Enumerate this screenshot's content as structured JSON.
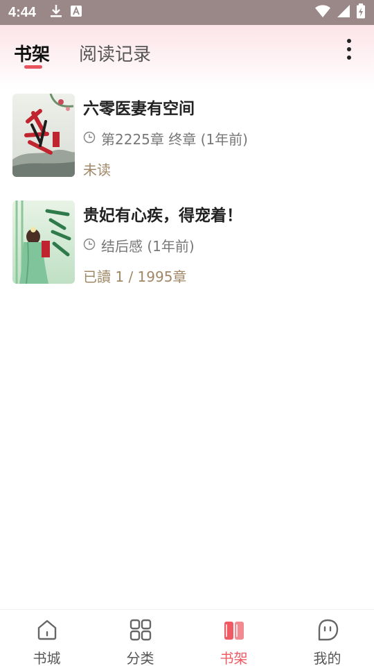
{
  "status_bar": {
    "time": "4:44",
    "icons": [
      "download-icon",
      "a-badge-icon",
      "wifi-icon",
      "signal-icon",
      "battery-icon"
    ]
  },
  "header": {
    "tabs": [
      {
        "label": "书架",
        "active": true
      },
      {
        "label": "阅读记录",
        "active": false
      }
    ],
    "more_icon": "more-vertical-icon"
  },
  "books": [
    {
      "title": "六零医妻有空间",
      "chapter": "第2225章 终章 (1年前)",
      "progress": "未读"
    },
    {
      "title": "贵妃有心疾，得宠着！",
      "chapter": "结后感 (1年前)",
      "progress": "已讀 1 / 1995章"
    }
  ],
  "bottom_nav": [
    {
      "label": "书城",
      "icon": "home-icon",
      "active": false
    },
    {
      "label": "分类",
      "icon": "grid-icon",
      "active": false
    },
    {
      "label": "书架",
      "icon": "bookshelf-icon",
      "active": true
    },
    {
      "label": "我的",
      "icon": "profile-face-icon",
      "active": false
    }
  ],
  "colors": {
    "accent": "#ef5a63",
    "progress_text": "#a08766",
    "status_bar": "#9a8788"
  }
}
